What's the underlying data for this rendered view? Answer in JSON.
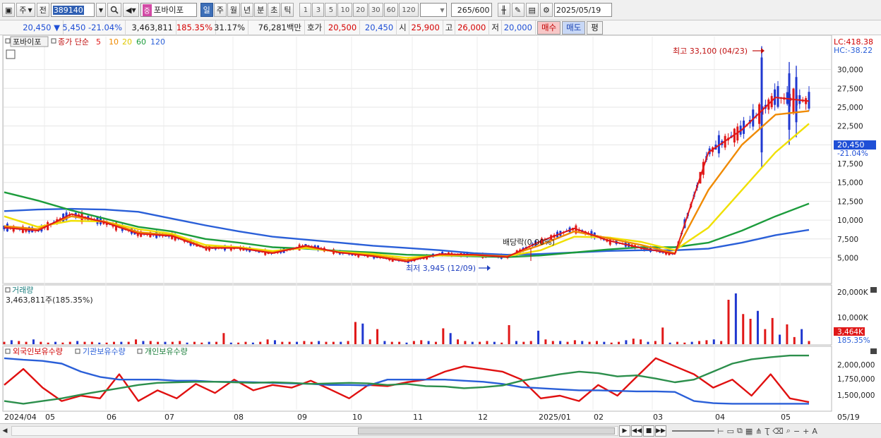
{
  "toolbar": {
    "period_mode": "주",
    "prev_label": "전",
    "code": "389140",
    "stock_name": "포바이포",
    "stock_tag": "중",
    "timeframes": [
      "일",
      "주",
      "월",
      "년",
      "분",
      "초",
      "틱"
    ],
    "intervals": [
      "1",
      "3",
      "5",
      "10",
      "20",
      "30",
      "60",
      "120"
    ],
    "count_value": "265",
    "count_total": "/600",
    "date": "2025/05/19"
  },
  "quote": {
    "price": "20,450",
    "arrow": "▼",
    "change": "5,450",
    "change_pct": "-21.04%",
    "volume": "3,463,811",
    "volume_ratio": "185.35%",
    "turnover": "31.17%",
    "amount": "76,281백만",
    "bid_label": "호가",
    "bid_price": "20,500",
    "ask_price": "20,450",
    "open_label": "시",
    "open": "25,900",
    "high_label": "고",
    "high": "26,000",
    "low_label": "저",
    "low": "20,000",
    "buy_label": "매수",
    "sell_label": "매도",
    "flat_label": "평"
  },
  "legend": {
    "name": "포바이포",
    "close_label": "종가 단순",
    "ma5": "5",
    "ma10": "10",
    "ma20": "20",
    "ma60": "60",
    "ma120": "120"
  },
  "annotations": {
    "lc": "LC:418.38",
    "hc": "HC:-38.22",
    "high_note": "최고 33,100 (04/23)",
    "low_note": "최저 3,945 (12/09)",
    "dividend_note": "배당락(0.00%)",
    "last_price": "20,450",
    "last_pct": "-21.04%"
  },
  "volume_panel": {
    "title": "거래량",
    "value": "3,463,811주(185.35%)",
    "last_label": "3,464K",
    "last_pct": "185.35%",
    "ticks": [
      "20,000K",
      "10,000K"
    ]
  },
  "holding_panel": {
    "foreign": "외국인보유수량",
    "institution": "기관보유수량",
    "individual": "개인보유수량",
    "ticks": [
      "2,000,000",
      "1,750,000",
      "1,500,000"
    ]
  },
  "colors": {
    "ma5": "#e01818",
    "ma10": "#f08a00",
    "ma20": "#f0e000",
    "ma60": "#1c9c3c",
    "ma120": "#2a5fd8",
    "up": "#e01818",
    "down": "#2038d0"
  },
  "chart_data": {
    "type": "line",
    "title": "포바이포",
    "y_ticks": [
      "30,000",
      "27,500",
      "25,000",
      "22,500",
      "20,000",
      "17,500",
      "15,000",
      "12,500",
      "10,000",
      "7,500",
      "5,000"
    ],
    "ylim": [
      2700,
      33800
    ],
    "x_labels": [
      "2024/04",
      "05",
      "06",
      "07",
      "08",
      "09",
      "10",
      "11",
      "12",
      "2025/01",
      "02",
      "03",
      "04",
      "05",
      "05/19"
    ],
    "series": [
      {
        "name": "5",
        "values": [
          9000,
          8600,
          10800,
          9700,
          8200,
          7900,
          6300,
          6300,
          5600,
          6600,
          5700,
          5200,
          4500,
          5500,
          5400,
          5100,
          7200,
          8900,
          7300,
          6300,
          5500,
          19000,
          22000,
          26300,
          25800
        ]
      },
      {
        "name": "10",
        "values": [
          9200,
          8800,
          10500,
          9800,
          8400,
          8000,
          6400,
          6300,
          5700,
          6500,
          5700,
          5300,
          4700,
          5400,
          5400,
          5200,
          6700,
          8500,
          7600,
          6700,
          5600,
          14000,
          20000,
          24000,
          24500
        ]
      },
      {
        "name": "20",
        "values": [
          10500,
          9100,
          9900,
          9800,
          8800,
          8200,
          6700,
          6400,
          5900,
          6300,
          5800,
          5500,
          5000,
          5300,
          5300,
          5200,
          6000,
          7800,
          7700,
          7100,
          6000,
          9000,
          14000,
          19000,
          22800
        ]
      },
      {
        "name": "60",
        "values": [
          13700,
          12600,
          11300,
          10200,
          9100,
          8500,
          7500,
          7000,
          6400,
          6200,
          5900,
          5700,
          5400,
          5300,
          5200,
          5100,
          5300,
          5700,
          6100,
          6400,
          6400,
          7000,
          8600,
          10500,
          12200
        ]
      },
      {
        "name": "120",
        "values": [
          11200,
          11400,
          11500,
          11400,
          11100,
          10200,
          9300,
          8500,
          7800,
          7400,
          7000,
          6600,
          6300,
          6000,
          5600,
          5400,
          5500,
          5700,
          5900,
          6000,
          6000,
          6200,
          7000,
          8000,
          8700
        ]
      }
    ],
    "volume": [
      3,
      5,
      4,
      3,
      6,
      3,
      2,
      3,
      2,
      3,
      4,
      3,
      3,
      2,
      2,
      3,
      3,
      3,
      6,
      4,
      4,
      3,
      3,
      3,
      4,
      2,
      3,
      2,
      3,
      3,
      14,
      2,
      2,
      3,
      2,
      3,
      6,
      5,
      3,
      3,
      3,
      4,
      3,
      4,
      3,
      3,
      3,
      4,
      28,
      26,
      6,
      19,
      4,
      3,
      3,
      2,
      4,
      5,
      4,
      3,
      20,
      14,
      6,
      4,
      3,
      3,
      4,
      3,
      2,
      24,
      4,
      3,
      4,
      17,
      6,
      4,
      4,
      3,
      5,
      4,
      3,
      4,
      3,
      2,
      3,
      5,
      7,
      6,
      3,
      4,
      21,
      2,
      3,
      2,
      3,
      4,
      5,
      6,
      4,
      56,
      64,
      38,
      32,
      42,
      19,
      33,
      12,
      25,
      9,
      19,
      4
    ],
    "volume_ylim": [
      0,
      22000
    ],
    "holding_ylim": [
      1150000,
      2230000
    ],
    "holding": [
      {
        "name": "외국인보유수량",
        "values": [
          1600000,
          1900000,
          1550000,
          1300000,
          1400000,
          1350000,
          1800000,
          1300000,
          1500000,
          1350000,
          1620000,
          1450000,
          1700000,
          1500000,
          1600000,
          1550000,
          1680000,
          1520000,
          1350000,
          1600000,
          1580000,
          1650000,
          1700000,
          1850000,
          1950000,
          1900000,
          1850000,
          1700000,
          1350000,
          1400000,
          1300000,
          1600000,
          1400000,
          1750000,
          2100000,
          1950000,
          1800000,
          1550000,
          1700000,
          1400000,
          1800000,
          1350000,
          1280000
        ]
      },
      {
        "name": "기관보유수량",
        "values": [
          2100000,
          2070000,
          2050000,
          2000000,
          1850000,
          1750000,
          1700000,
          1700000,
          1700000,
          1680000,
          1680000,
          1660000,
          1660000,
          1650000,
          1640000,
          1630000,
          1620000,
          1600000,
          1600000,
          1590000,
          1700000,
          1700000,
          1700000,
          1700000,
          1680000,
          1660000,
          1620000,
          1560000,
          1540000,
          1520000,
          1500000,
          1500000,
          1490000,
          1480000,
          1480000,
          1470000,
          1300000,
          1260000,
          1250000,
          1250000,
          1250000,
          1250000,
          1250000
        ]
      },
      {
        "name": "개인보유수량",
        "values": [
          1300000,
          1250000,
          1300000,
          1350000,
          1420000,
          1480000,
          1540000,
          1600000,
          1640000,
          1650000,
          1660000,
          1660000,
          1650000,
          1640000,
          1650000,
          1640000,
          1620000,
          1630000,
          1640000,
          1630000,
          1600000,
          1620000,
          1580000,
          1570000,
          1540000,
          1560000,
          1590000,
          1680000,
          1740000,
          1800000,
          1850000,
          1820000,
          1760000,
          1780000,
          1720000,
          1650000,
          1700000,
          1850000,
          2000000,
          2080000,
          2120000,
          2150000,
          2150000
        ]
      }
    ]
  }
}
